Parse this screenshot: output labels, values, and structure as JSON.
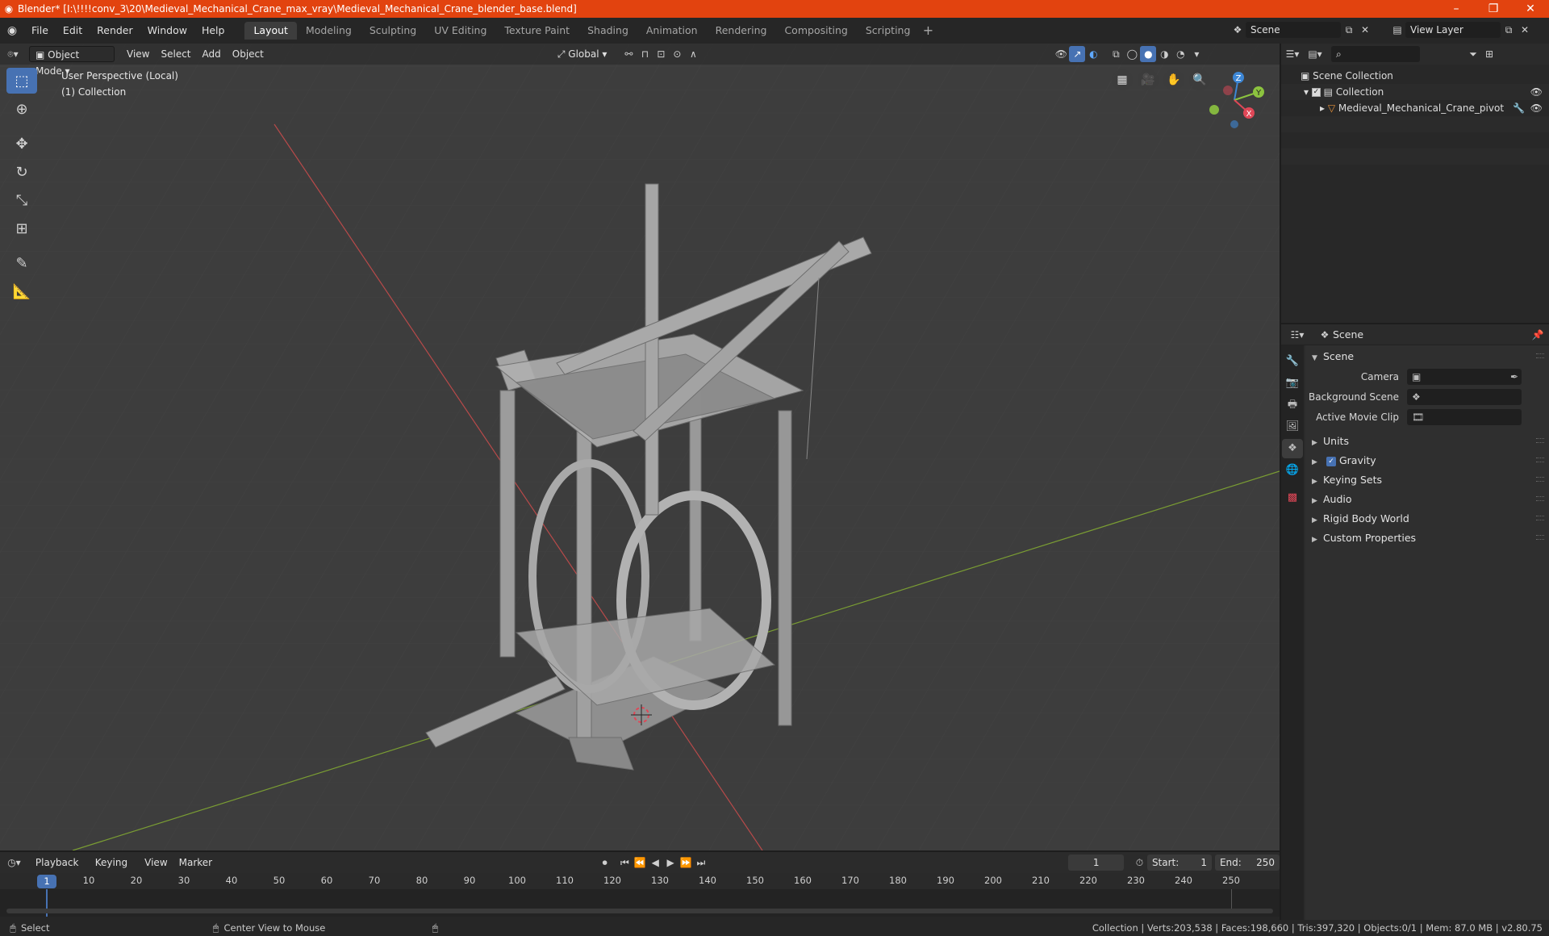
{
  "window": {
    "title": "Blender* [I:\\!!!!conv_3\\20\\Medieval_Mechanical_Crane_max_vray\\Medieval_Mechanical_Crane_blender_base.blend]",
    "minimize": "–",
    "maximize": "❐",
    "close": "✕"
  },
  "menu": {
    "items": [
      "File",
      "Edit",
      "Render",
      "Window",
      "Help"
    ],
    "workspaces": [
      "Layout",
      "Modeling",
      "Sculpting",
      "UV Editing",
      "Texture Paint",
      "Shading",
      "Animation",
      "Rendering",
      "Compositing",
      "Scripting"
    ],
    "active_workspace": "Layout",
    "add": "+",
    "scene": "Scene",
    "view_layer": "View Layer"
  },
  "viewport": {
    "mode": "Object Mode",
    "menus": [
      "View",
      "Select",
      "Add",
      "Object"
    ],
    "transform_orientation": "Global",
    "info_line1": "User Perspective (Local)",
    "info_line2": "(1) Collection",
    "axes": {
      "x": "X",
      "y": "Y",
      "z": "Z"
    }
  },
  "outliner": {
    "search_placeholder": "",
    "scene_collection": "Scene Collection",
    "collection": "Collection",
    "object": "Medieval_Mechanical_Crane_pivot"
  },
  "properties": {
    "header_title": "Scene",
    "panel_title": "Scene",
    "fields": [
      {
        "label": "Camera",
        "value": ""
      },
      {
        "label": "Background Scene",
        "value": ""
      },
      {
        "label": "Active Movie Clip",
        "value": ""
      }
    ],
    "subpanels": [
      "Units",
      "Gravity",
      "Keying Sets",
      "Audio",
      "Rigid Body World",
      "Custom Properties"
    ],
    "gravity_checked": true
  },
  "timeline": {
    "menus": [
      "Playback",
      "Keying",
      "View",
      "Marker"
    ],
    "current_frame": "1",
    "start_label": "Start:",
    "start": "1",
    "end_label": "End:",
    "end": "250",
    "ruler": [
      "10",
      "20",
      "30",
      "40",
      "50",
      "60",
      "70",
      "80",
      "90",
      "100",
      "110",
      "120",
      "130",
      "140",
      "150",
      "160",
      "170",
      "180",
      "190",
      "200",
      "210",
      "220",
      "230",
      "240",
      "250"
    ],
    "playhead_label": "1"
  },
  "status": {
    "left": "Select",
    "middle": "Center View to Mouse",
    "stats": "Collection | Verts:203,538 | Faces:198,660 | Tris:397,320 | Objects:0/1 | Mem: 87.0 MB | v2.80.75"
  },
  "colors": {
    "title_bar": "#e2430f",
    "accent": "#4772b3",
    "x_axis": "#e04757",
    "y_axis": "#8cc33f",
    "z_axis": "#3d87d6"
  }
}
